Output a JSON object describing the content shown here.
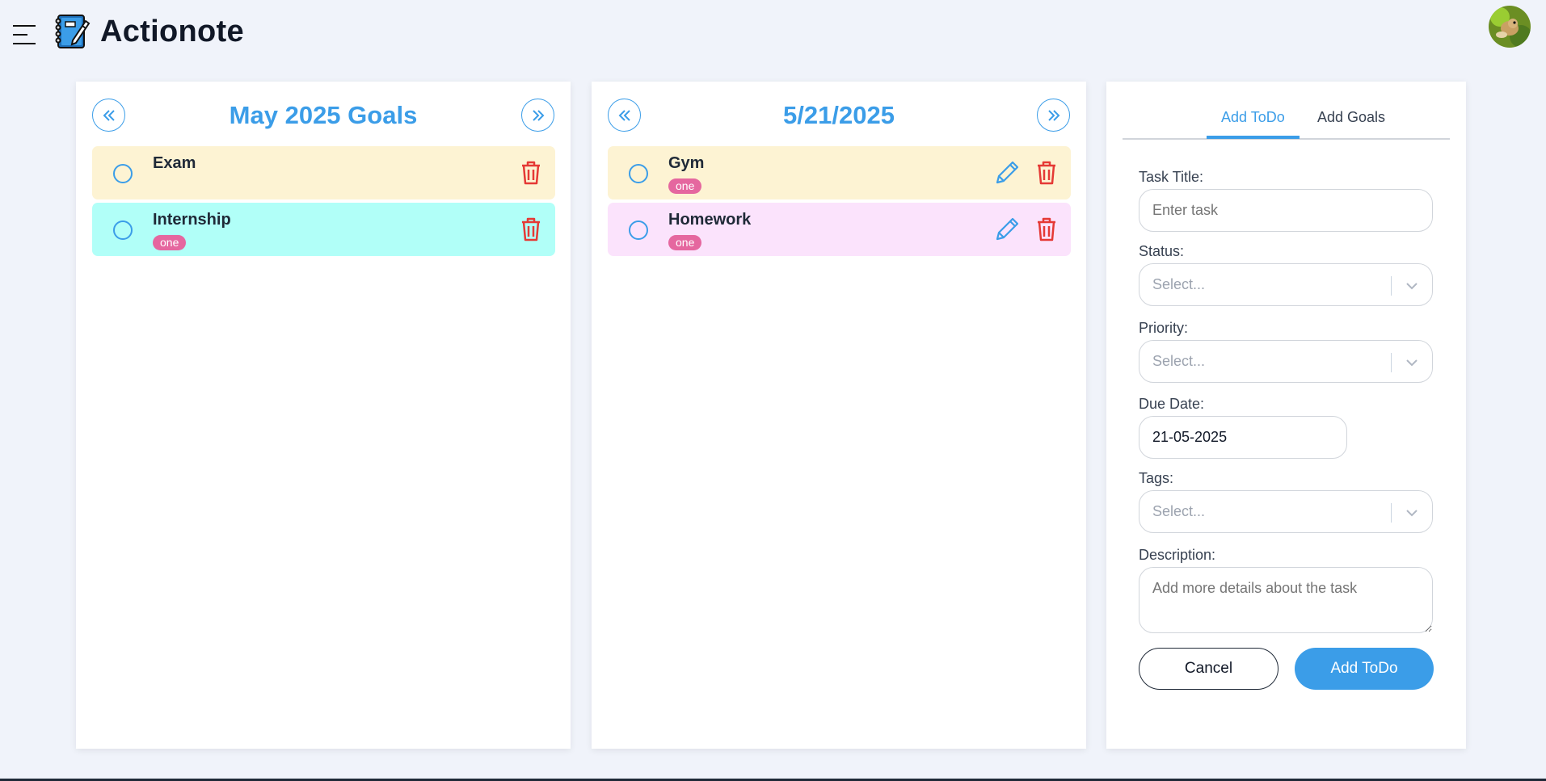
{
  "app": {
    "title": "Actionote"
  },
  "colors": {
    "accent": "#3b9de8",
    "danger": "#e53935",
    "tag": "#e5679f"
  },
  "goals_panel": {
    "title": "May 2025 Goals",
    "items": [
      {
        "name": "Exam",
        "tag": "",
        "color": "#fdf3d3"
      },
      {
        "name": "Internship",
        "tag": "one",
        "color": "#b1fff8"
      }
    ]
  },
  "todos_panel": {
    "title": "5/21/2025",
    "items": [
      {
        "name": "Gym",
        "tag": "one",
        "color": "#fdf3d3"
      },
      {
        "name": "Homework",
        "tag": "one",
        "color": "#fbe3fc"
      }
    ]
  },
  "form": {
    "tabs": [
      {
        "label": "Add ToDo",
        "active": true
      },
      {
        "label": "Add Goals",
        "active": false
      }
    ],
    "task_title_label": "Task Title:",
    "task_title_placeholder": "Enter task",
    "status_label": "Status:",
    "status_value": "Select...",
    "priority_label": "Priority:",
    "priority_value": "Select...",
    "due_date_label": "Due Date:",
    "due_date_value": "21-05-2025",
    "tags_label": "Tags:",
    "tags_value": "Select...",
    "description_label": "Description:",
    "description_placeholder": "Add more details about the task",
    "cancel_label": "Cancel",
    "submit_label": "Add ToDo"
  },
  "icons": [
    "hamburger-menu-icon",
    "notebook-logo-icon",
    "user-avatar",
    "double-chevron-left-icon",
    "double-chevron-right-icon",
    "circle-checkbox-icon",
    "trash-icon",
    "pencil-edit-icon",
    "chevron-down-icon"
  ]
}
